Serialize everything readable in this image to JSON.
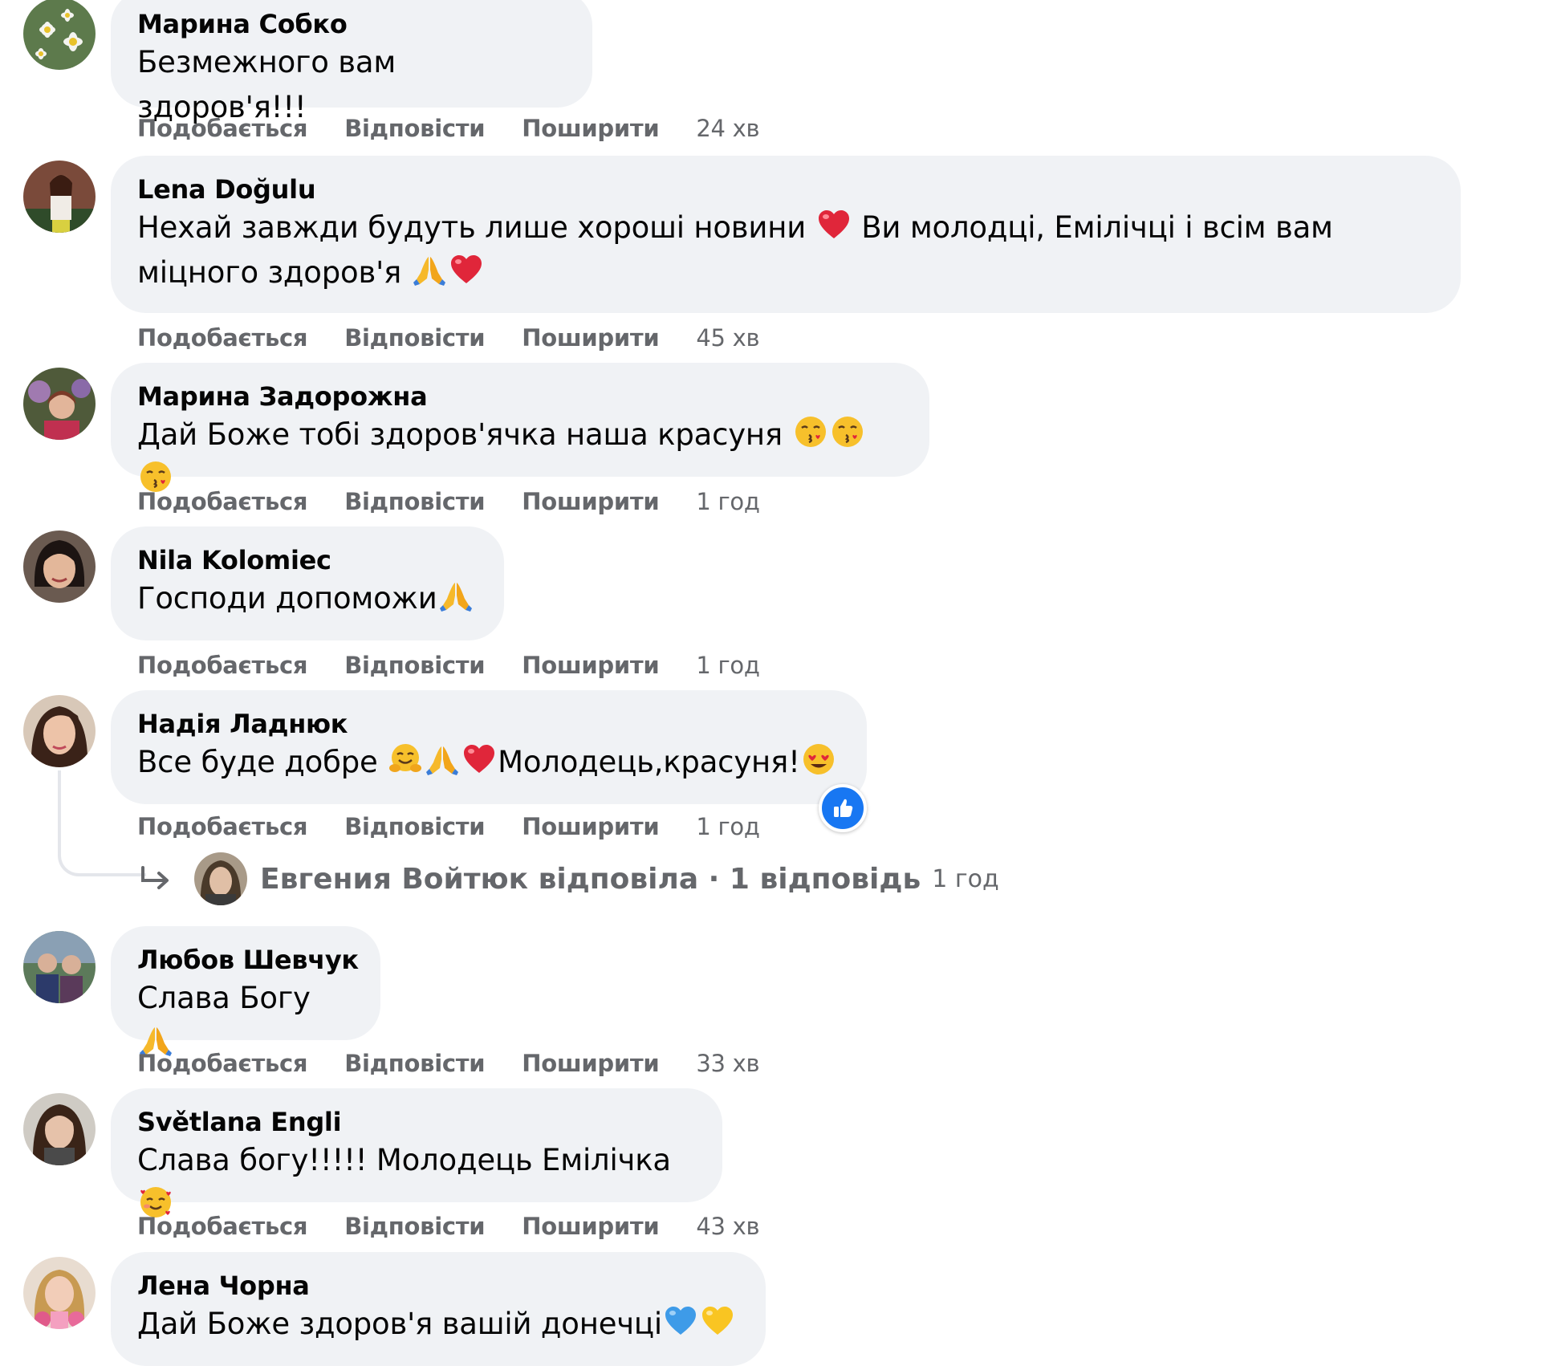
{
  "actions": {
    "like": "Подобається",
    "reply": "Відповісти",
    "share": "Поширити"
  },
  "comments": [
    {
      "author": "Марина Собко",
      "text": "Безмежного вам здоров'я!!!",
      "time": "24 хв",
      "avatar_icon": "daisy-flowers-avatar"
    },
    {
      "author": "Lena Doğulu",
      "text1": "Нехай завжди будуть лише хороші новини",
      "text2": "Ви молодці, Емілічці і всім вам",
      "text3": "міцного здоров'я",
      "time": "45 хв",
      "avatar_icon": "person-photo-avatar"
    },
    {
      "author": "Марина Задорожна",
      "text": "Дай Боже тобі здоров'ячка наша красуня",
      "time": "1 год",
      "avatar_icon": "person-photo-avatar"
    },
    {
      "author": "Nila Kolomiec",
      "text": "Господи допоможи",
      "time": "1 год",
      "avatar_icon": "person-photo-avatar"
    },
    {
      "author": "Надія Ладнюк",
      "text1": "Все буде добре",
      "text2": "Молодець,красуня!",
      "time": "1 год",
      "avatar_icon": "person-photo-avatar"
    },
    {
      "author": "Любов Шевчук",
      "text": "Слава Богу",
      "time": "33 хв",
      "avatar_icon": "person-photo-avatar"
    },
    {
      "author": "Světlana Engli",
      "text": "Слава богу!!!!! Молодець Емілічка",
      "time": "43 хв",
      "avatar_icon": "person-photo-avatar"
    },
    {
      "author": "Лена Чорна",
      "text": "Дай Боже здоров'я вашій донечці",
      "time": "",
      "avatar_icon": "person-photo-avatar"
    }
  ],
  "reply_thread": {
    "text": "Евгения Войтюк відповіла · 1 відповідь",
    "time": "1 год"
  },
  "colors": {
    "bubble": "#f0f2f5",
    "secondary_text": "#65676b",
    "like_blue": "#1877f2",
    "heart_red": "#e0263a"
  }
}
